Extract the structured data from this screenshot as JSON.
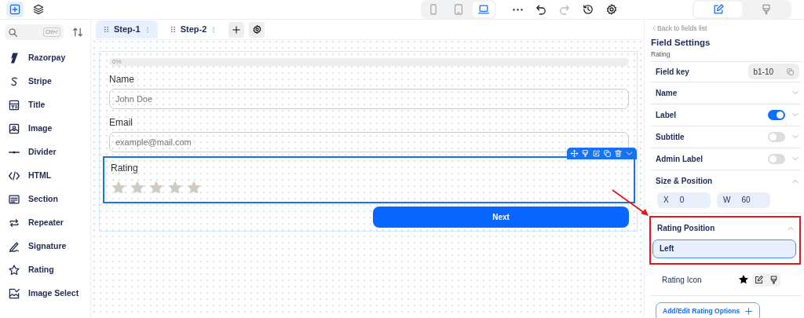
{
  "toolbar": {
    "left_tabs": [
      {
        "selected": true
      },
      {
        "selected": false
      }
    ],
    "devices": [
      {
        "selected": false
      },
      {
        "selected": false
      },
      {
        "selected": true
      }
    ],
    "actions": [
      {
        "disabled": false
      },
      {
        "disabled": false
      },
      {
        "disabled": true
      },
      {
        "disabled": false
      },
      {
        "disabled": false
      }
    ],
    "panel_tabs": [
      {
        "selected": true
      },
      {
        "selected": false
      }
    ]
  },
  "sidebar": {
    "search": {
      "shortcut": "Ctrl+/"
    },
    "items": [
      {
        "label": "Razorpay"
      },
      {
        "label": "Stripe"
      },
      {
        "label": "Title"
      },
      {
        "label": "Image"
      },
      {
        "label": "Divider"
      },
      {
        "label": "HTML"
      },
      {
        "label": "Section"
      },
      {
        "label": "Repeater"
      },
      {
        "label": "Signature"
      },
      {
        "label": "Rating"
      },
      {
        "label": "Image Select"
      }
    ]
  },
  "steps": [
    {
      "label": "Step-1",
      "selected": true
    },
    {
      "label": "Step-2",
      "selected": false
    }
  ],
  "form": {
    "progress": {
      "label": "0%",
      "level": 0
    },
    "fields": [
      {
        "kind": "text",
        "label": "Name",
        "placeholder": "John Doe",
        "selected": false
      },
      {
        "kind": "text",
        "label": "Email",
        "placeholder": "example@mail.com",
        "selected": false
      },
      {
        "kind": "rating",
        "label": "Rating",
        "stars": 0,
        "selected": true
      }
    ],
    "button": "Next"
  },
  "settings": {
    "back": "Back to fields list",
    "title": "Field Settings",
    "subtitle": "Rating",
    "field_key": {
      "label": "Field key",
      "value": "b1-10"
    },
    "rows": [
      {
        "kind": "collapse",
        "label": "Name",
        "expanded": false
      },
      {
        "kind": "toggle",
        "label": "Label",
        "on": true,
        "expanded": false
      },
      {
        "kind": "toggle",
        "label": "Subtitle",
        "on": false,
        "expanded": false
      },
      {
        "kind": "toggle",
        "label": "Admin Label",
        "on": false,
        "expanded": false
      },
      {
        "kind": "size",
        "label": "Size & Position",
        "expanded": true,
        "inputs": [
          {
            "label": "X",
            "value": "0"
          },
          {
            "label": "W",
            "value": "60"
          }
        ]
      },
      {
        "kind": "select",
        "label": "Rating Position",
        "expanded": true,
        "value": "Left",
        "highlighted": true
      },
      {
        "kind": "icon",
        "label": "Rating Icon"
      }
    ],
    "add_button": "Add/Edit Rating Options"
  }
}
